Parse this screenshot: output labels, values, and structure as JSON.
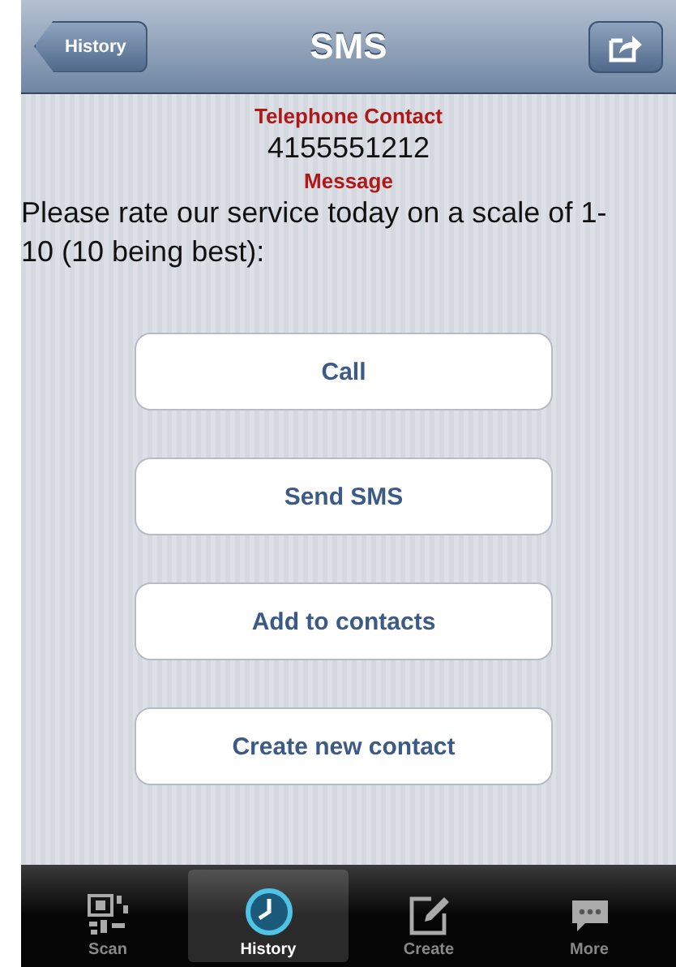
{
  "nav_bar": {
    "back_button": "History",
    "title": "SMS"
  },
  "details": [
    {
      "kind": "label",
      "text": "Telephone Contact"
    },
    {
      "kind": "value",
      "text": "4155551212"
    },
    {
      "kind": "label",
      "text": "Message"
    },
    {
      "kind": "body",
      "text": "Please rate our service today on a scale of 1-10 (10 being best):"
    }
  ],
  "buttons": [
    "Call",
    "Send SMS",
    "Add to contacts",
    "Create new contact"
  ],
  "tab_bar": [
    {
      "label": "Scan",
      "kind": "qr",
      "selected": false
    },
    {
      "label": "History",
      "kind": "clock",
      "selected": true
    },
    {
      "label": "Create",
      "kind": "edit",
      "selected": false
    },
    {
      "label": "More",
      "kind": "chat",
      "selected": false
    }
  ]
}
